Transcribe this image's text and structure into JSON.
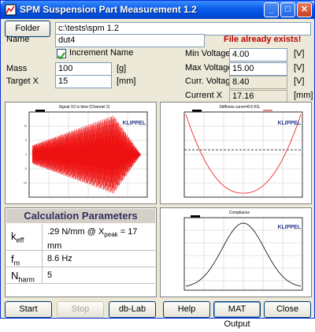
{
  "window": {
    "title": "SPM Suspension Part Measurement 1.2",
    "controls": {
      "minimize": "_",
      "maximize": "□",
      "close": "✕"
    }
  },
  "folder": {
    "button_label": "Folder",
    "path": "c:\\tests\\spm 1.2"
  },
  "name": {
    "label": "Name",
    "value": "dut4",
    "warning": "File already exists!"
  },
  "increment_name": {
    "label": "Increment Name",
    "checked": true
  },
  "mass": {
    "label": "Mass",
    "value": "100",
    "unit": "[g]"
  },
  "target_x": {
    "label": "Target X",
    "value": "15",
    "unit": "[mm]"
  },
  "min_voltage": {
    "label": "Min Voltage",
    "value": "4.00",
    "unit": "[V]"
  },
  "max_voltage": {
    "label": "Max Voltage",
    "value": "15.00",
    "unit": "[V]"
  },
  "curr_voltage": {
    "label": "Curr. Voltage",
    "value": "8.40",
    "unit": "[V]"
  },
  "current_x": {
    "label": "Current X",
    "value": "17.16",
    "unit": "[mm]"
  },
  "charts": {
    "signal": {
      "title": "Signal X2 is time (Channel 2)",
      "logo": "KLIPPEL",
      "color": "#ee1111"
    },
    "stiffness": {
      "title": "Stiffness curve=8.6 KG",
      "logo": "KLIPPEL",
      "color": "#ee1111"
    },
    "compliance": {
      "title": "Compliance",
      "logo": "KLIPPEL",
      "color": "#000000"
    }
  },
  "calc": {
    "title": "Calculation Parameters",
    "rows": [
      {
        "symbol": "k",
        "sub": "eff",
        "value": ".29 N/mm @ X",
        "value_sub": "peak",
        "value_tail": " = 17 mm"
      },
      {
        "symbol": "f",
        "sub": "m",
        "value": "8.6 Hz"
      },
      {
        "symbol": "N",
        "sub": "harm",
        "value": "5"
      }
    ]
  },
  "buttons": {
    "start": "Start",
    "stop": "Stop",
    "dblab": "db-Lab",
    "help": "Help",
    "mat_output": "MAT Output",
    "close": "Close"
  }
}
